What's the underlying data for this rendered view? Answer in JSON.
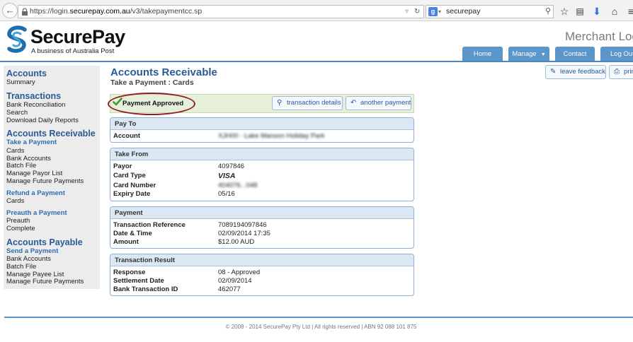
{
  "browser": {
    "url_prefix": "https://login.",
    "url_domain": "securepay.com.au",
    "url_path": "/v3/takepaymentcc.sp",
    "search_text": "securepay"
  },
  "header": {
    "brand_name": "SecurePay",
    "brand_tagline": "A business of Australia Post",
    "title": "Merchant Log",
    "nav": [
      "Home",
      "Manage",
      "Contact",
      "Log Out"
    ]
  },
  "sidebar": {
    "accounts": {
      "title": "Accounts",
      "items": [
        "Summary"
      ]
    },
    "transactions": {
      "title": "Transactions",
      "items": [
        "Bank Reconciliation",
        "Search",
        "Download Daily Reports"
      ]
    },
    "accounts_receivable": {
      "title": "Accounts Receivable",
      "take_payment": "Take a Payment",
      "take_payment_items": [
        "Cards",
        "Bank Accounts",
        "Batch File",
        "Manage Payor List",
        "Manage Future Payments"
      ],
      "refund": "Refund a Payment",
      "refund_items": [
        "Cards"
      ],
      "preauth": "Preauth a Payment",
      "preauth_items": [
        "Preauth",
        "Complete"
      ]
    },
    "accounts_payable": {
      "title": "Accounts Payable",
      "send_payment": "Send a Payment",
      "send_items": [
        "Bank Accounts",
        "Batch File",
        "Manage Payee List",
        "Manage Future Payments"
      ]
    }
  },
  "main": {
    "title": "Accounts Receivable",
    "subtitle": "Take a Payment : Cards",
    "leave_feedback": "leave feedback",
    "print": "prin",
    "status": "Payment Approved",
    "transaction_details": "transaction details",
    "another_payment": "another payment",
    "pay_to": {
      "title": "Pay To",
      "rows": [
        {
          "key": "Account",
          "value": "XJH00 - Lake Manson Holiday Park"
        }
      ]
    },
    "take_from": {
      "title": "Take From",
      "rows": [
        {
          "key": "Payor",
          "value": "4097846"
        },
        {
          "key": "Card Type",
          "value": "VISA"
        },
        {
          "key": "Card Number",
          "value": "404076...048"
        },
        {
          "key": "Expiry Date",
          "value": "05/16"
        }
      ]
    },
    "payment": {
      "title": "Payment",
      "rows": [
        {
          "key": "Transaction Reference",
          "value": "7089194097846"
        },
        {
          "key": "Date & Time",
          "value": "02/09/2014 17:35"
        },
        {
          "key": "Amount",
          "value": "$12.00 AUD"
        }
      ]
    },
    "transaction_result": {
      "title": "Transaction Result",
      "rows": [
        {
          "key": "Response",
          "value": "08 - Approved"
        },
        {
          "key": "Settlement Date",
          "value": "02/09/2014"
        },
        {
          "key": "Bank Transaction ID",
          "value": "462077"
        }
      ]
    }
  },
  "footer": "© 2008 - 2014 SecurePay Pty Ltd | All rights reserved | ABN 92 088 101 875",
  "colors": {
    "brand_blue": "#2a5a96",
    "nav_blue": "#5b95c9",
    "approved_bg": "#e6efd9",
    "highlight_oval": "#8f1f1f"
  }
}
